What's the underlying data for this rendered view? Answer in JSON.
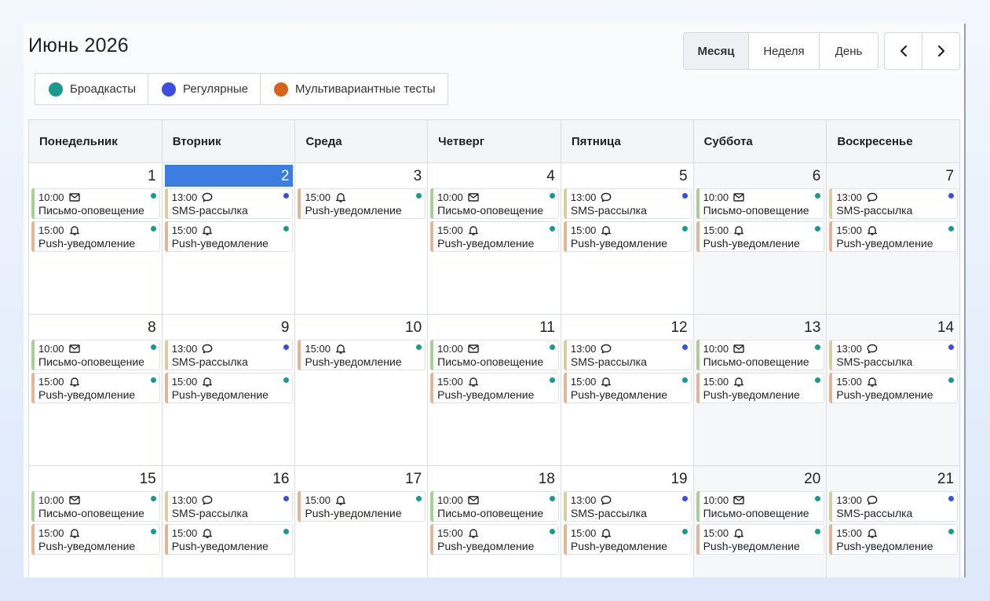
{
  "header": {
    "title": "Июнь 2026"
  },
  "legend": [
    {
      "label": "Броадкасты",
      "color": "#1a9a8f"
    },
    {
      "label": "Регулярные",
      "color": "#3b4ee0"
    },
    {
      "label": "Мультивариантные тесты",
      "color": "#d9621a"
    }
  ],
  "views": [
    {
      "label": "Месяц",
      "active": true
    },
    {
      "label": "Неделя",
      "active": false
    },
    {
      "label": "День",
      "active": false
    }
  ],
  "weekdays": [
    "Понедельник",
    "Вторник",
    "Среда",
    "Четверг",
    "Пятница",
    "Суббота",
    "Воскресенье"
  ],
  "colors": {
    "bar_email": "#a9cf95",
    "bar_sms": "#d7cfa0",
    "bar_push": "#e0b598",
    "dot_broadcast": "#1a9a8f",
    "dot_regular": "#3b4ee0",
    "today": "#3b7de0"
  },
  "weeks": [
    {
      "days": [
        {
          "num": "1",
          "events": [
            {
              "time": "10:00",
              "icon": "mail-icon",
              "name": "Письмо-оповещение",
              "bar": "email",
              "dot": "broadcast"
            },
            {
              "time": "15:00",
              "icon": "bell-icon",
              "name": "Push-уведомление",
              "bar": "push",
              "dot": "broadcast"
            }
          ]
        },
        {
          "num": "2",
          "today": true,
          "events": [
            {
              "time": "13:00",
              "icon": "chat-icon",
              "name": "SMS-рассылка",
              "bar": "sms",
              "dot": "regular"
            },
            {
              "time": "15:00",
              "icon": "bell-icon",
              "name": "Push-уведомление",
              "bar": "push",
              "dot": "broadcast"
            }
          ]
        },
        {
          "num": "3",
          "events": [
            {
              "time": "15:00",
              "icon": "bell-icon",
              "name": "Push-уведомление",
              "bar": "push",
              "dot": "broadcast"
            }
          ]
        },
        {
          "num": "4",
          "events": [
            {
              "time": "10:00",
              "icon": "mail-icon",
              "name": "Письмо-оповещение",
              "bar": "email",
              "dot": "broadcast"
            },
            {
              "time": "15:00",
              "icon": "bell-icon",
              "name": "Push-уведомление",
              "bar": "push",
              "dot": "broadcast"
            }
          ]
        },
        {
          "num": "5",
          "events": [
            {
              "time": "13:00",
              "icon": "chat-icon",
              "name": "SMS-рассылка",
              "bar": "sms",
              "dot": "regular"
            },
            {
              "time": "15:00",
              "icon": "bell-icon",
              "name": "Push-уведомление",
              "bar": "push",
              "dot": "broadcast"
            }
          ]
        },
        {
          "num": "6",
          "weekend": true,
          "events": [
            {
              "time": "10:00",
              "icon": "mail-icon",
              "name": "Письмо-оповещение",
              "bar": "email",
              "dot": "broadcast"
            },
            {
              "time": "15:00",
              "icon": "bell-icon",
              "name": "Push-уведомление",
              "bar": "push",
              "dot": "broadcast"
            }
          ]
        },
        {
          "num": "7",
          "weekend": true,
          "events": [
            {
              "time": "13:00",
              "icon": "chat-icon",
              "name": "SMS-рассылка",
              "bar": "sms",
              "dot": "regular"
            },
            {
              "time": "15:00",
              "icon": "bell-icon",
              "name": "Push-уведомление",
              "bar": "push",
              "dot": "broadcast"
            }
          ]
        }
      ]
    },
    {
      "days": [
        {
          "num": "8",
          "events": [
            {
              "time": "10:00",
              "icon": "mail-icon",
              "name": "Письмо-оповещение",
              "bar": "email",
              "dot": "broadcast"
            },
            {
              "time": "15:00",
              "icon": "bell-icon",
              "name": "Push-уведомление",
              "bar": "push",
              "dot": "broadcast"
            }
          ]
        },
        {
          "num": "9",
          "events": [
            {
              "time": "13:00",
              "icon": "chat-icon",
              "name": "SMS-рассылка",
              "bar": "sms",
              "dot": "regular"
            },
            {
              "time": "15:00",
              "icon": "bell-icon",
              "name": "Push-уведомление",
              "bar": "push",
              "dot": "broadcast"
            }
          ]
        },
        {
          "num": "10",
          "events": [
            {
              "time": "15:00",
              "icon": "bell-icon",
              "name": "Push-уведомление",
              "bar": "push",
              "dot": "broadcast"
            }
          ]
        },
        {
          "num": "11",
          "events": [
            {
              "time": "10:00",
              "icon": "mail-icon",
              "name": "Письмо-оповещение",
              "bar": "email",
              "dot": "broadcast"
            },
            {
              "time": "15:00",
              "icon": "bell-icon",
              "name": "Push-уведомление",
              "bar": "push",
              "dot": "broadcast"
            }
          ]
        },
        {
          "num": "12",
          "events": [
            {
              "time": "13:00",
              "icon": "chat-icon",
              "name": "SMS-рассылка",
              "bar": "sms",
              "dot": "regular"
            },
            {
              "time": "15:00",
              "icon": "bell-icon",
              "name": "Push-уведомление",
              "bar": "push",
              "dot": "broadcast"
            }
          ]
        },
        {
          "num": "13",
          "weekend": true,
          "events": [
            {
              "time": "10:00",
              "icon": "mail-icon",
              "name": "Письмо-оповещение",
              "bar": "email",
              "dot": "broadcast"
            },
            {
              "time": "15:00",
              "icon": "bell-icon",
              "name": "Push-уведомление",
              "bar": "push",
              "dot": "broadcast"
            }
          ]
        },
        {
          "num": "14",
          "weekend": true,
          "events": [
            {
              "time": "13:00",
              "icon": "chat-icon",
              "name": "SMS-рассылка",
              "bar": "sms",
              "dot": "regular"
            },
            {
              "time": "15:00",
              "icon": "bell-icon",
              "name": "Push-уведомление",
              "bar": "push",
              "dot": "broadcast"
            }
          ]
        }
      ]
    },
    {
      "days": [
        {
          "num": "15",
          "events": [
            {
              "time": "10:00",
              "icon": "mail-icon",
              "name": "Письмо-оповещение",
              "bar": "email",
              "dot": "broadcast"
            },
            {
              "time": "15:00",
              "icon": "bell-icon",
              "name": "Push-уведомление",
              "bar": "push",
              "dot": "broadcast"
            }
          ]
        },
        {
          "num": "16",
          "events": [
            {
              "time": "13:00",
              "icon": "chat-icon",
              "name": "SMS-рассылка",
              "bar": "sms",
              "dot": "regular"
            },
            {
              "time": "15:00",
              "icon": "bell-icon",
              "name": "Push-уведомление",
              "bar": "push",
              "dot": "broadcast"
            }
          ]
        },
        {
          "num": "17",
          "events": [
            {
              "time": "15:00",
              "icon": "bell-icon",
              "name": "Push-уведомление",
              "bar": "push",
              "dot": "broadcast"
            }
          ]
        },
        {
          "num": "18",
          "events": [
            {
              "time": "10:00",
              "icon": "mail-icon",
              "name": "Письмо-оповещение",
              "bar": "email",
              "dot": "broadcast"
            },
            {
              "time": "15:00",
              "icon": "bell-icon",
              "name": "Push-уведомление",
              "bar": "push",
              "dot": "broadcast"
            }
          ]
        },
        {
          "num": "19",
          "events": [
            {
              "time": "13:00",
              "icon": "chat-icon",
              "name": "SMS-рассылка",
              "bar": "sms",
              "dot": "regular"
            },
            {
              "time": "15:00",
              "icon": "bell-icon",
              "name": "Push-уведомление",
              "bar": "push",
              "dot": "broadcast"
            }
          ]
        },
        {
          "num": "20",
          "weekend": true,
          "events": [
            {
              "time": "10:00",
              "icon": "mail-icon",
              "name": "Письмо-оповещение",
              "bar": "email",
              "dot": "broadcast"
            },
            {
              "time": "15:00",
              "icon": "bell-icon",
              "name": "Push-уведомление",
              "bar": "push",
              "dot": "broadcast"
            }
          ]
        },
        {
          "num": "21",
          "weekend": true,
          "events": [
            {
              "time": "13:00",
              "icon": "chat-icon",
              "name": "SMS-рассылка",
              "bar": "sms",
              "dot": "regular"
            },
            {
              "time": "15:00",
              "icon": "bell-icon",
              "name": "Push-уведомление",
              "bar": "push",
              "dot": "broadcast"
            }
          ]
        }
      ]
    }
  ]
}
